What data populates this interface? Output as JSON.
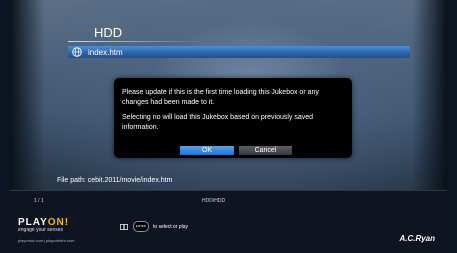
{
  "header": {
    "title": "HDD"
  },
  "file_list": [
    {
      "name": "index.htm",
      "icon": "globe-icon"
    }
  ],
  "dialog": {
    "message1": "Please update if this is the first time loading this Jukebox or any changes had been made to it.",
    "message2": "Selecting no will load this Jukebox based on previously saved information.",
    "ok_label": "OK",
    "cancel_label": "Cancel"
  },
  "file_path": "File path: cebit.2011/movie/index.htm",
  "footer": {
    "counter": "1 / 1",
    "source": "HDD/HDD",
    "logo_main": "PLAY",
    "logo_accent": "ON!",
    "tagline": "engage your senses",
    "urls": "playonhd.com | playonhdnr.com",
    "hint_enter": "ENTER",
    "hint_text": "to select or play",
    "brand": "A.C.Ryan"
  },
  "colors": {
    "selection": "#2c62a8",
    "ok_button": "#3a86dc",
    "logo_accent": "#f0b400"
  }
}
